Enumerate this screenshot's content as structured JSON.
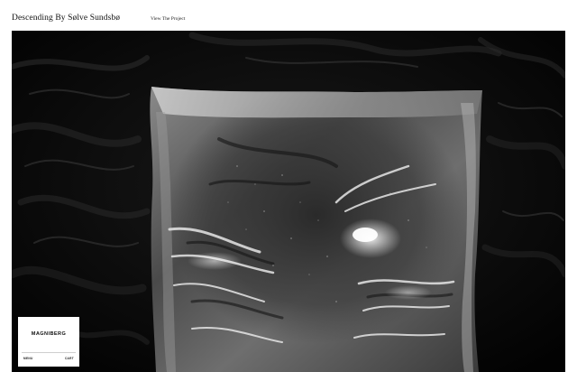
{
  "header": {
    "site_title": "Descending By Sølve Sundsbø",
    "project_link": "View The Project"
  },
  "hero": {
    "image_icon": "silver-pillow-on-black-satin-image"
  },
  "brand_card": {
    "logo": "MAGNIBERG",
    "menu_label": "MENU",
    "cart_label": "CART"
  }
}
